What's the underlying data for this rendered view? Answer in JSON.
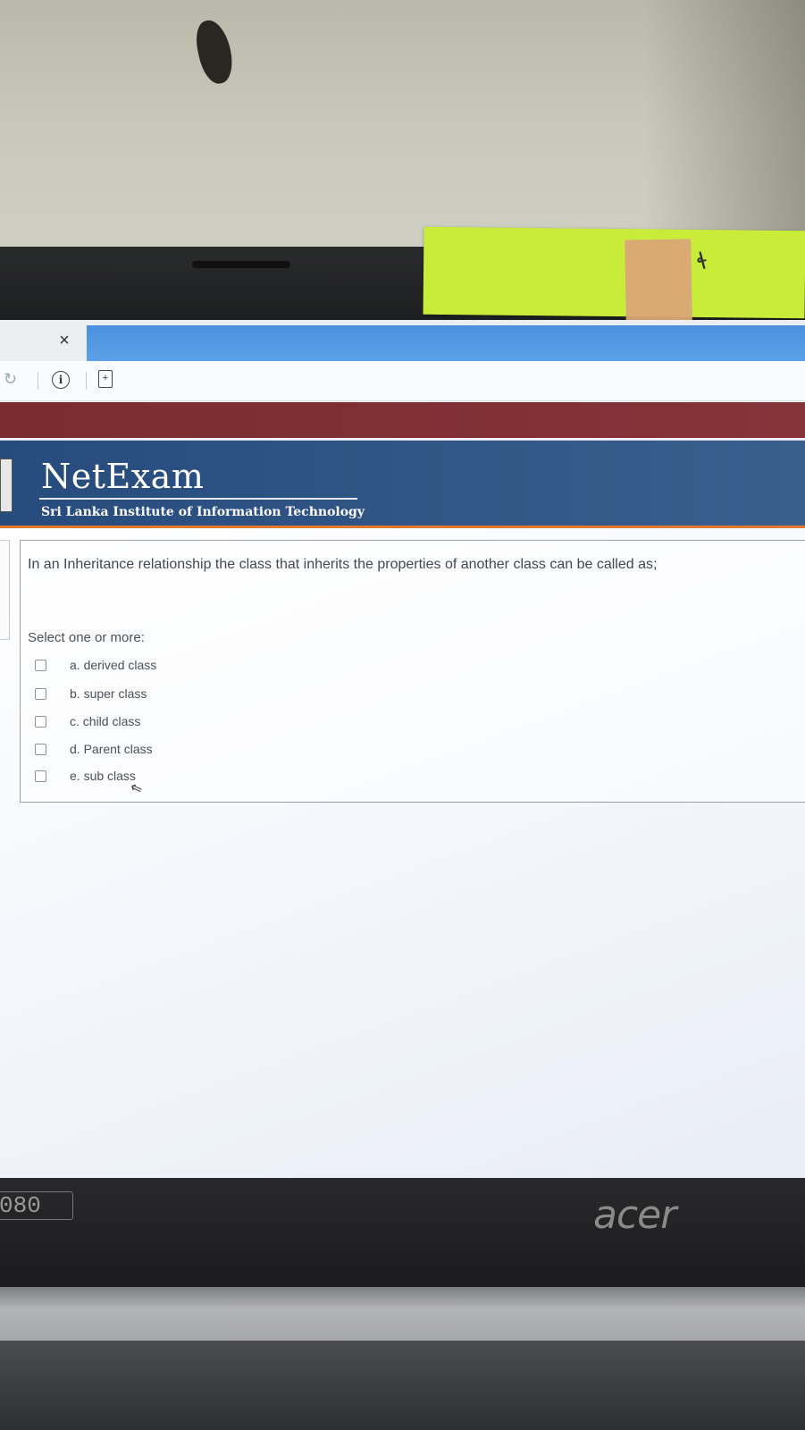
{
  "browser": {
    "tab_close_glyph": "×",
    "reload_glyph": "↻",
    "info_glyph": "i",
    "page_glyph": "+"
  },
  "header": {
    "title": "NetExam",
    "subtitle": "Sri Lanka Institute of Information Technology"
  },
  "question": {
    "text": "In an Inheritance relationship the class that inherits the properties of another class can be called as;",
    "instruction": "Select one or more:",
    "options": [
      {
        "label": "a. derived class",
        "checked": false
      },
      {
        "label": "b. super class",
        "checked": false
      },
      {
        "label": "c. child class",
        "checked": false
      },
      {
        "label": "d. Parent class",
        "checked": false
      },
      {
        "label": "e. sub class",
        "checked": false
      }
    ]
  },
  "monitor": {
    "resolution_badge": "080",
    "brand": "acer"
  },
  "colors": {
    "header_band": "#2f527f",
    "maroon_bar": "#7f2f34",
    "orange_rule": "#e0792b",
    "sticky_note": "#c9ec3b"
  },
  "icons": [
    "close-icon",
    "reload-icon",
    "info-icon",
    "page-icon",
    "checkbox-icon",
    "mouse-cursor-icon"
  ]
}
